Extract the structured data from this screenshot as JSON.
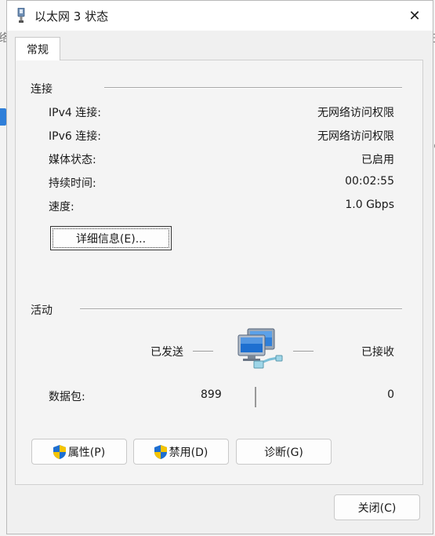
{
  "background": {
    "fragment_left": "络",
    "fragment_right": "在",
    "fragment_right2": "sc"
  },
  "window": {
    "title": "以太网 3 状态",
    "close_glyph": "✕"
  },
  "tabs": [
    {
      "label": "常规"
    }
  ],
  "connection": {
    "heading": "连接",
    "rows": [
      {
        "label": "IPv4 连接:",
        "value": "无网络访问权限"
      },
      {
        "label": "IPv6 连接:",
        "value": "无网络访问权限"
      },
      {
        "label": "媒体状态:",
        "value": "已启用"
      },
      {
        "label": "持续时间:",
        "value": "00:02:55"
      },
      {
        "label": "速度:",
        "value": "1.0 Gbps"
      }
    ],
    "details_button": "详细信息(E)..."
  },
  "activity": {
    "heading": "活动",
    "sent_label": "已发送",
    "received_label": "已接收",
    "packets_label": "数据包:",
    "packets_sent": "899",
    "packets_received": "0"
  },
  "actions": {
    "properties": "属性(P)",
    "disable": "禁用(D)",
    "diagnose": "诊断(G)",
    "close": "关闭(C)"
  },
  "icons": {
    "title": "network-adapter-icon",
    "shield": "uac-shield-icon",
    "activity": "network-computers-icon"
  },
  "colors": {
    "accent": "#2f7fd9",
    "shield_blue": "#1e6fd0",
    "shield_yellow": "#f5c400"
  }
}
